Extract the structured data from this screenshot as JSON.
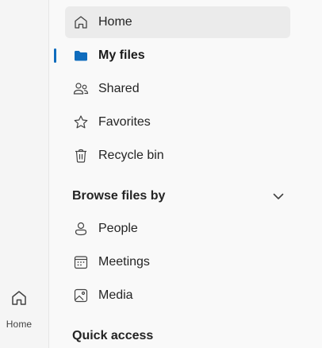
{
  "nav": {
    "items": [
      {
        "label": "Home",
        "icon": "home-icon",
        "state": "hover"
      },
      {
        "label": "My files",
        "icon": "folder-icon",
        "state": "selected"
      },
      {
        "label": "Shared",
        "icon": "people-icon"
      },
      {
        "label": "Favorites",
        "icon": "star-icon"
      },
      {
        "label": "Recycle bin",
        "icon": "trash-icon"
      }
    ],
    "browse": {
      "title": "Browse files by",
      "items": [
        {
          "label": "People",
          "icon": "person-icon"
        },
        {
          "label": "Meetings",
          "icon": "calendar-icon"
        },
        {
          "label": "Media",
          "icon": "image-icon"
        }
      ]
    },
    "quick_access": {
      "title": "Quick access"
    }
  },
  "rail": {
    "home_label": "Home"
  },
  "colors": {
    "accent": "#0f6cbd",
    "hover": "#ebebeb"
  }
}
